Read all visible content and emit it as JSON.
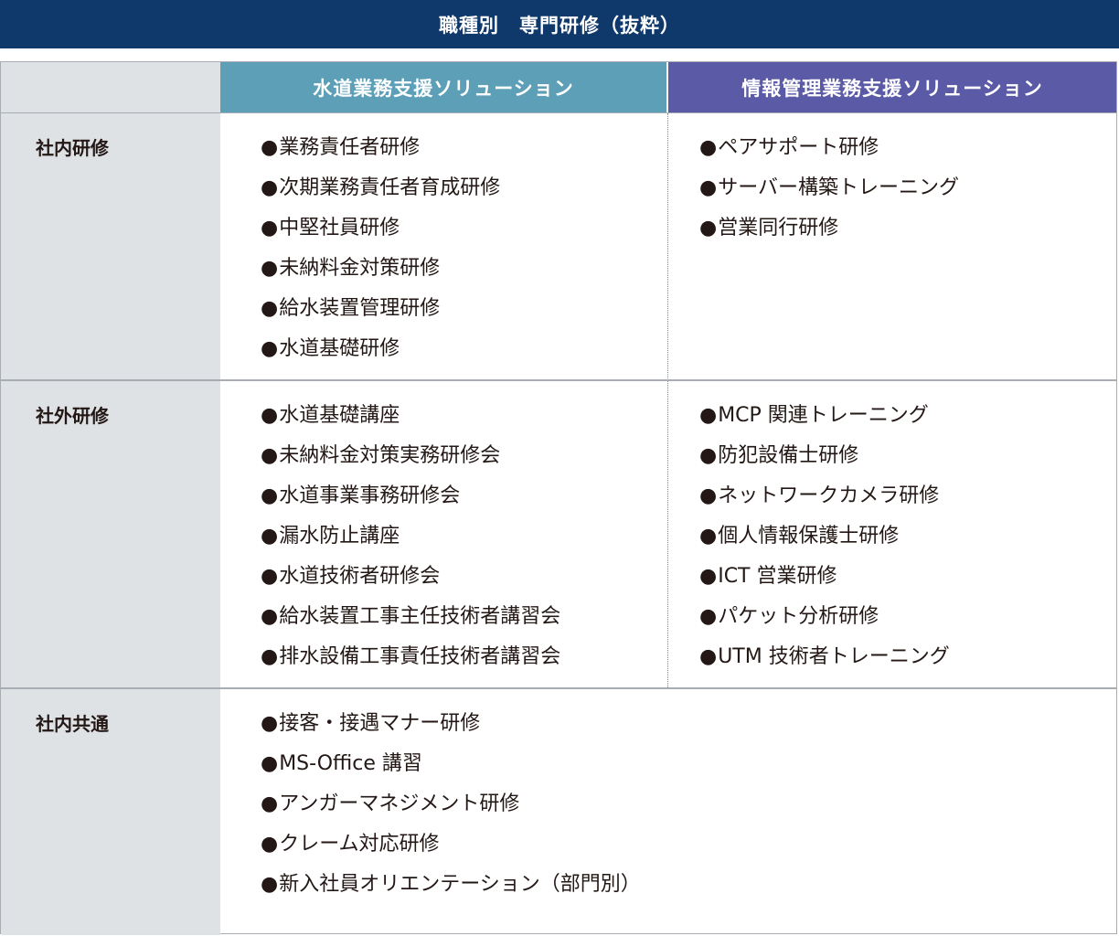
{
  "title": "職種別　専門研修（抜粋）",
  "bullet": "●",
  "columns": {
    "water": "水道業務支援ソリューション",
    "info": "情報管理業務支援ソリューション"
  },
  "rows": [
    {
      "label": "社内研修",
      "water": [
        "業務責任者研修",
        "次期業務責任者育成研修",
        "中堅社員研修",
        "未納料金対策研修",
        "給水装置管理研修",
        "水道基礎研修"
      ],
      "info": [
        "ペアサポート研修",
        "サーバー構築トレーニング",
        "営業同行研修"
      ]
    },
    {
      "label": "社外研修",
      "water": [
        "水道基礎講座",
        "未納料金対策実務研修会",
        "水道事業事務研修会",
        "漏水防止講座",
        "水道技術者研修会",
        "給水装置工事主任技術者講習会",
        "排水設備工事責任技術者講習会"
      ],
      "info": [
        "MCP 関連トレーニング",
        "防犯設備士研修",
        "ネットワークカメラ研修",
        "個人情報保護士研修",
        "ICT 営業研修",
        "パケット分析研修",
        "UTM 技術者トレーニング"
      ]
    },
    {
      "label": "社内共通",
      "common": [
        "接客・接遇マナー研修",
        "MS-Office 講習",
        "アンガーマネジメント研修",
        "クレーム対応研修",
        "新入社員オリエンテーション（部門別）"
      ]
    }
  ],
  "colors": {
    "title_bar": "#10396b",
    "water_header": "#5c9fb6",
    "info_header": "#5a5aa6",
    "label_column": "#dfe2e5"
  }
}
